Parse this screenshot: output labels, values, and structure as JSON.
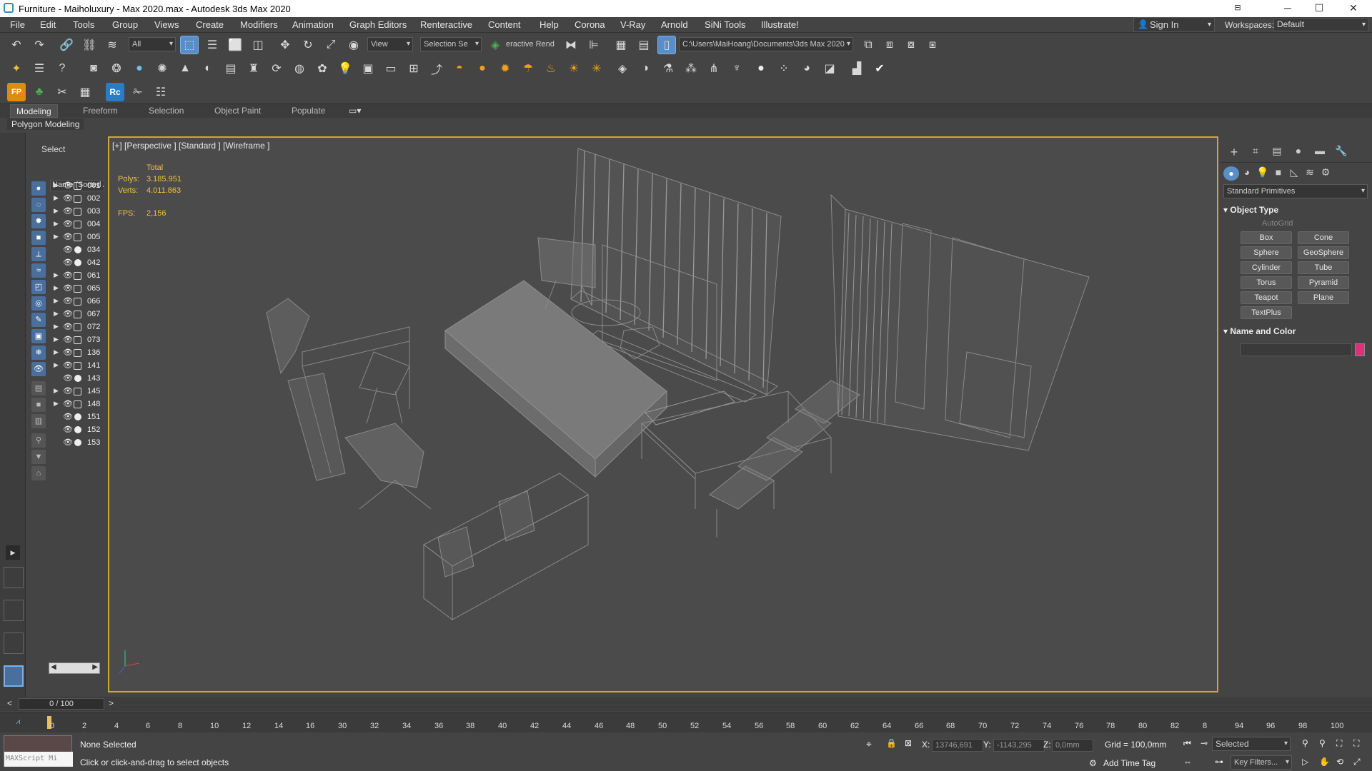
{
  "window": {
    "title": "Furniture - Maiholuxury - Max 2020.max - Autodesk 3ds Max 2020",
    "controls": [
      "─",
      "☐",
      "✕"
    ]
  },
  "menu": [
    "File",
    "Edit",
    "Tools",
    "Group",
    "Views",
    "Create",
    "Modifiers",
    "Animation",
    "Graph Editors",
    "Renteractive",
    "Content",
    "Help",
    "Corona",
    "V-Ray",
    "Arnold",
    "SiNi Tools",
    "Illustrate!"
  ],
  "account": {
    "signin": "Sign In",
    "workspaces_label": "Workspaces:",
    "workspace": "Default"
  },
  "toolbar": {
    "filter": "All",
    "refcoord": "View",
    "selection_set": "Selection Se",
    "interactive": "eractive Rend",
    "project_path": "C:\\Users\\MaiHoang\\Documents\\3ds Max 2020"
  },
  "ribbon": {
    "tabs": [
      "Modeling",
      "Freeform",
      "Selection",
      "Object Paint",
      "Populate"
    ],
    "active": "Modeling",
    "panel": "Polygon Modeling"
  },
  "explorer": {
    "title": "Select",
    "column": "Name (Sorted A",
    "rows": [
      {
        "name": "001",
        "group": true
      },
      {
        "name": "002",
        "group": true
      },
      {
        "name": "003",
        "group": true
      },
      {
        "name": "004",
        "group": true
      },
      {
        "name": "005",
        "group": true
      },
      {
        "name": "034",
        "group": false
      },
      {
        "name": "042",
        "group": false
      },
      {
        "name": "061",
        "group": true
      },
      {
        "name": "065",
        "group": true
      },
      {
        "name": "066",
        "group": true
      },
      {
        "name": "067",
        "group": true
      },
      {
        "name": "072",
        "group": true
      },
      {
        "name": "073",
        "group": true
      },
      {
        "name": "136",
        "group": true
      },
      {
        "name": "141",
        "group": true
      },
      {
        "name": "143",
        "group": false
      },
      {
        "name": "145",
        "group": true
      },
      {
        "name": "148",
        "group": true
      },
      {
        "name": "151",
        "group": false
      },
      {
        "name": "152",
        "group": false
      },
      {
        "name": "153",
        "group": false
      }
    ]
  },
  "viewport": {
    "label": "[+] [Perspective ] [Standard ] [Wireframe ]",
    "stats": {
      "total_label": "Total",
      "polys_label": "Polys:",
      "polys": "3.185.951",
      "verts_label": "Verts:",
      "verts": "4.011.863",
      "fps_label": "FPS:",
      "fps": "2,156"
    }
  },
  "command_panel": {
    "category": "Standard Primitives",
    "object_type_title": "Object Type",
    "autogrid": "AutoGrid",
    "buttons": [
      "Box",
      "Cone",
      "Sphere",
      "GeoSphere",
      "Cylinder",
      "Tube",
      "Torus",
      "Pyramid",
      "Teapot",
      "Plane",
      "TextPlus"
    ],
    "name_color_title": "Name and Color",
    "swatch_color": "#e0307a"
  },
  "timeline": {
    "frame": "0 / 100",
    "ticks": [
      "0",
      "2",
      "4",
      "6",
      "8",
      "10",
      "12",
      "14",
      "16",
      "30",
      "32",
      "34",
      "36",
      "38",
      "40",
      "42",
      "44",
      "46",
      "48",
      "50",
      "52",
      "54",
      "56",
      "58",
      "60",
      "62",
      "64",
      "66",
      "68",
      "70",
      "72",
      "74",
      "76",
      "78",
      "80",
      "82",
      "8",
      "94",
      "96",
      "98",
      "100"
    ]
  },
  "status": {
    "maxscript": "MAXScript Mi",
    "selection": "None Selected",
    "prompt": "Click or click-and-drag to select objects",
    "x_label": "X:",
    "x": "13746,691",
    "y_label": "Y:",
    "y": "-1143,295",
    "z_label": "Z:",
    "z": "0,0mm",
    "grid": "Grid = 100,0mm",
    "add_time_tag": "Add Time Tag",
    "key_mode": "Selected",
    "key_filters": "Key Filters..."
  }
}
